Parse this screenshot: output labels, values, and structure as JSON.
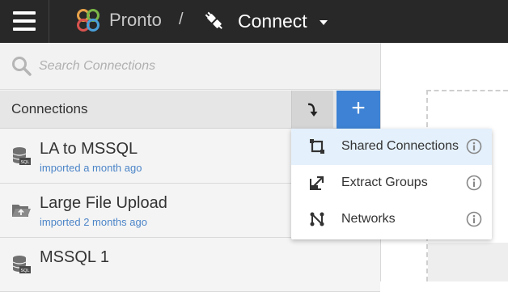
{
  "topbar": {
    "app_name": "Pronto",
    "separator": "/",
    "section": "Connect",
    "icons": [
      "menu-icon",
      "pronto-logo",
      "connect-plug-icon",
      "chevron-down-icon"
    ]
  },
  "search": {
    "placeholder": "Search Connections",
    "value": ""
  },
  "connections": {
    "header_label": "Connections",
    "add_button_label": "+",
    "items": [
      {
        "name": "LA to MSSQL",
        "subtitle": "imported a month ago",
        "icon": "sql-database-icon"
      },
      {
        "name": "Large File Upload",
        "subtitle": "imported 2 months ago",
        "icon": "folder-upload-icon"
      },
      {
        "name": "MSSQL 1",
        "subtitle": "",
        "icon": "sql-database-icon"
      }
    ]
  },
  "dropdown": {
    "items": [
      {
        "label": "Shared Connections",
        "icon": "shared-connections-icon",
        "active": true
      },
      {
        "label": "Extract Groups",
        "icon": "extract-groups-icon",
        "active": false
      },
      {
        "label": "Networks",
        "icon": "networks-icon",
        "active": false
      }
    ]
  },
  "colors": {
    "topbar": "#282828",
    "accent_blue": "#3d82d4",
    "link_blue": "#4c85c8",
    "active_menu_bg": "#e4f0fb"
  }
}
